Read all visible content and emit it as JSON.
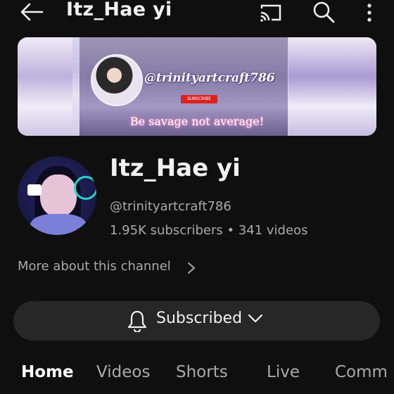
{
  "header": {
    "title": "Itz_Hae yi",
    "icons": [
      "back-arrow-icon",
      "cast-icon",
      "search-icon",
      "more-vert-icon"
    ]
  },
  "banner": {
    "handle": "@trinityartcraft786",
    "subscribe_badge": "SUBSCRIBE",
    "tagline": "Be savage not average!"
  },
  "channel": {
    "name": "Itz_Hae yi",
    "handle": "@trinityartcraft786",
    "stats": "1.95K subscribers • 341 videos",
    "about": "More about this channel"
  },
  "subscribe_button": {
    "label": "Subscribed"
  },
  "tabs": [
    {
      "label": "Home",
      "active": true
    },
    {
      "label": "Videos",
      "active": false
    },
    {
      "label": "Shorts",
      "active": false
    },
    {
      "label": "Live",
      "active": false
    },
    {
      "label": "Comm",
      "active": false
    }
  ],
  "colors": {
    "background": "#0f0f0f",
    "button_bg": "#272727",
    "secondary_text": "#aaaaaa"
  }
}
